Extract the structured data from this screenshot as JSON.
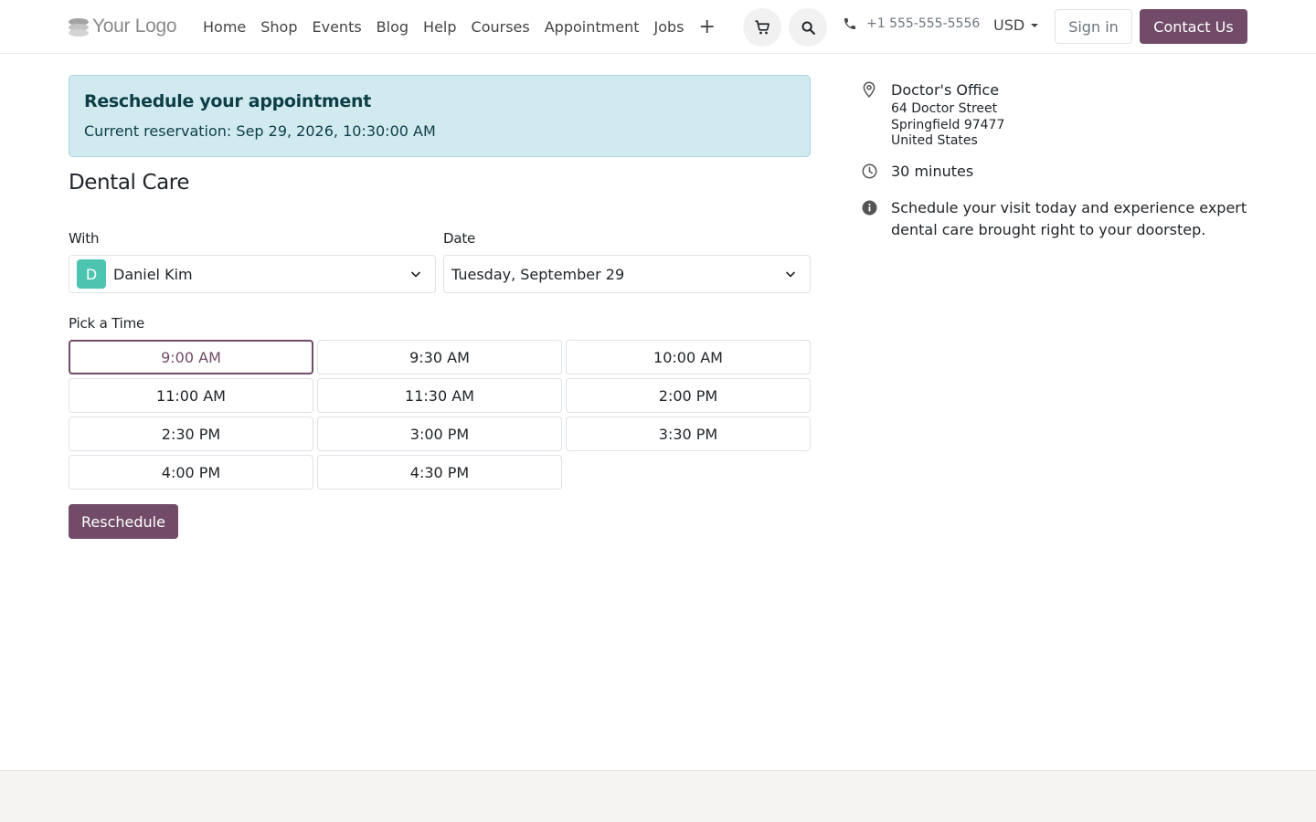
{
  "header": {
    "logo_text": "Your Logo",
    "nav": [
      "Home",
      "Shop",
      "Events",
      "Blog",
      "Help",
      "Courses",
      "Appointment",
      "Jobs"
    ],
    "add_icon": "plus-icon",
    "phone": "+1 555-555-5556",
    "currency": "USD",
    "signin_label": "Sign in",
    "contact_label": "Contact Us",
    "accent_color": "#714b67"
  },
  "alert": {
    "title": "Reschedule your appointment",
    "text": "Current reservation: Sep 29, 2026, 10:30:00 AM"
  },
  "appointment": {
    "title": "Dental Care",
    "with_label": "With",
    "with_value": "Daniel Kim",
    "with_avatar": "D",
    "date_label": "Date",
    "date_value": "Tuesday, September 29",
    "pick_label": "Pick a Time",
    "slots": [
      "9:00 AM",
      "9:30 AM",
      "10:00 AM",
      "11:00 AM",
      "11:30 AM",
      "2:00 PM",
      "2:30 PM",
      "3:00 PM",
      "3:30 PM",
      "4:00 PM",
      "4:30 PM"
    ],
    "selected_slot": "9:00 AM",
    "button_label": "Reschedule"
  },
  "info": {
    "location_name": "Doctor's Office",
    "address": [
      "64 Doctor Street",
      "Springfield 97477",
      "United States"
    ],
    "duration": "30 minutes",
    "description": "Schedule your visit today and experience expert dental care brought right to your doorstep."
  }
}
